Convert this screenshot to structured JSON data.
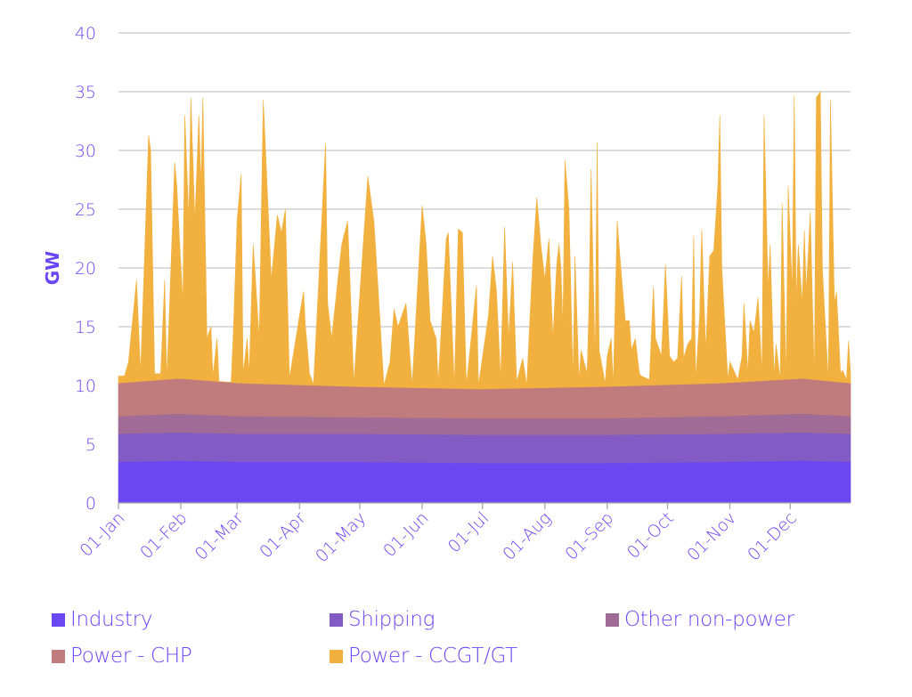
{
  "chart_data": {
    "type": "area",
    "stacked": true,
    "title": "",
    "xlabel": "",
    "ylabel": "GW",
    "ylim": [
      0,
      40
    ],
    "yticks": [
      0,
      5,
      10,
      15,
      20,
      25,
      30,
      35,
      40
    ],
    "xlim_days": [
      0,
      364
    ],
    "grid": "horizontal",
    "legend_position": "bottom",
    "x_tick_labels": [
      "01-Jan",
      "01-Feb",
      "01-Mar",
      "01-Apr",
      "01-May",
      "01-Jun",
      "01-Jul",
      "01-Aug",
      "01-Sep",
      "01-Oct",
      "01-Nov",
      "01-Dec"
    ],
    "x_tick_days": [
      0,
      31,
      59,
      90,
      120,
      151,
      181,
      212,
      243,
      273,
      304,
      334
    ],
    "series": [
      {
        "name": "Industry",
        "color": "#6b47f2",
        "anchors_day": [
          0,
          30,
          60,
          120,
          180,
          240,
          300,
          340,
          364
        ],
        "anchors_value": [
          3.5,
          3.6,
          3.5,
          3.5,
          3.4,
          3.4,
          3.5,
          3.6,
          3.5
        ]
      },
      {
        "name": "Shipping",
        "color": "#835bc4",
        "anchors_day": [
          0,
          30,
          60,
          120,
          180,
          240,
          300,
          340,
          364
        ],
        "anchors_value": [
          2.4,
          2.4,
          2.4,
          2.4,
          2.4,
          2.4,
          2.4,
          2.4,
          2.4
        ]
      },
      {
        "name": "Other non-power",
        "color": "#a06b96",
        "anchors_day": [
          0,
          30,
          60,
          120,
          180,
          240,
          300,
          340,
          364
        ],
        "anchors_value": [
          1.5,
          1.6,
          1.5,
          1.4,
          1.4,
          1.4,
          1.5,
          1.6,
          1.5
        ]
      },
      {
        "name": "Power - CHP",
        "color": "#c07b7c",
        "anchors_day": [
          0,
          30,
          60,
          120,
          180,
          240,
          300,
          340,
          364
        ],
        "anchors_value": [
          2.8,
          3.0,
          2.8,
          2.6,
          2.5,
          2.7,
          2.8,
          3.0,
          2.8
        ]
      },
      {
        "name": "Power - CCGT/GT",
        "color": "#f2b13f",
        "total_anchors_day": [
          0,
          3,
          5,
          9,
          11,
          15,
          16,
          18,
          21,
          23,
          24,
          28,
          29,
          32,
          33,
          35,
          36,
          38,
          40,
          41,
          42,
          44,
          46,
          47,
          49,
          50,
          56,
          57,
          59,
          61,
          62,
          64,
          65,
          67,
          70,
          72,
          76,
          79,
          81,
          83,
          85,
          92,
          93,
          95,
          97,
          103,
          104,
          106,
          111,
          114,
          117,
          124,
          127,
          129,
          132,
          135,
          137,
          139,
          143,
          146,
          151,
          153,
          155,
          158,
          159,
          163,
          164,
          167,
          169,
          171,
          173,
          178,
          179,
          184,
          186,
          188,
          190,
          192,
          194,
          196,
          198,
          201,
          203,
          206,
          208,
          210,
          212,
          214,
          216,
          218,
          219,
          220,
          221,
          222,
          224,
          226,
          227,
          229,
          230,
          233,
          234,
          235,
          237,
          238,
          239,
          242,
          243,
          245,
          246,
          248,
          250,
          252,
          254,
          255,
          257,
          259,
          260,
          264,
          266,
          267,
          269,
          270,
          272,
          274,
          276,
          278,
          280,
          281,
          283,
          285,
          286,
          287,
          289,
          290,
          292,
          294,
          296,
          298,
          299,
          300,
          303,
          304,
          308,
          310,
          311,
          313,
          314,
          316,
          318,
          320,
          321,
          323,
          324,
          326,
          327,
          329,
          330,
          332,
          333,
          335,
          336,
          337,
          338,
          340,
          341,
          342,
          344,
          346,
          347,
          349,
          350,
          353,
          354,
          356,
          357,
          359,
          360,
          362,
          363,
          364
        ],
        "total_anchors_value": [
          10.8,
          10.8,
          12,
          19,
          11,
          31.3,
          30,
          11,
          11,
          19,
          10.3,
          29,
          27,
          17,
          33,
          24,
          34.5,
          24,
          33,
          27,
          34.5,
          14,
          15,
          10.8,
          14,
          10.3,
          10.2,
          14,
          24,
          28,
          11,
          14,
          11,
          22,
          14,
          34.3,
          19,
          24.5,
          23,
          25,
          10.6,
          18,
          15,
          11,
          10.1,
          30.6,
          17,
          14,
          22,
          24,
          10.2,
          27.8,
          24,
          18.5,
          10,
          12,
          16.5,
          15,
          17,
          10,
          25.3,
          22,
          15.5,
          14,
          10.2,
          22.5,
          23,
          10,
          23.3,
          23,
          10,
          18.5,
          10,
          16,
          21,
          18,
          10.5,
          23.5,
          14,
          20.5,
          10.3,
          12.3,
          10,
          20.7,
          26,
          22,
          19,
          22.5,
          14,
          20.5,
          22,
          20,
          15,
          29.2,
          25,
          10.5,
          21,
          10.4,
          13,
          11,
          17,
          28.4,
          12,
          30.7,
          13,
          10.2,
          12.5,
          14,
          10,
          24,
          19.5,
          15.5,
          15.5,
          13,
          14,
          11,
          10.8,
          10.5,
          18.4,
          14,
          13,
          12.5,
          20.3,
          12.5,
          12,
          12.3,
          19.3,
          12.3,
          13.5,
          14,
          22.7,
          10.5,
          16,
          23.3,
          13,
          21,
          21.5,
          27,
          33,
          20,
          10.5,
          12,
          10.5,
          12.5,
          17,
          11,
          15.5,
          14.5,
          17.5,
          11,
          33,
          18,
          22,
          10.8,
          13.5,
          10.5,
          25.5,
          10.5,
          27,
          18,
          34.7,
          17,
          22,
          17,
          23.2,
          18,
          24.8,
          10.3,
          34.5,
          35,
          20,
          10.2,
          34.3,
          17,
          18,
          11,
          11.3,
          10.5,
          13.8,
          11,
          10.8
        ]
      }
    ]
  }
}
